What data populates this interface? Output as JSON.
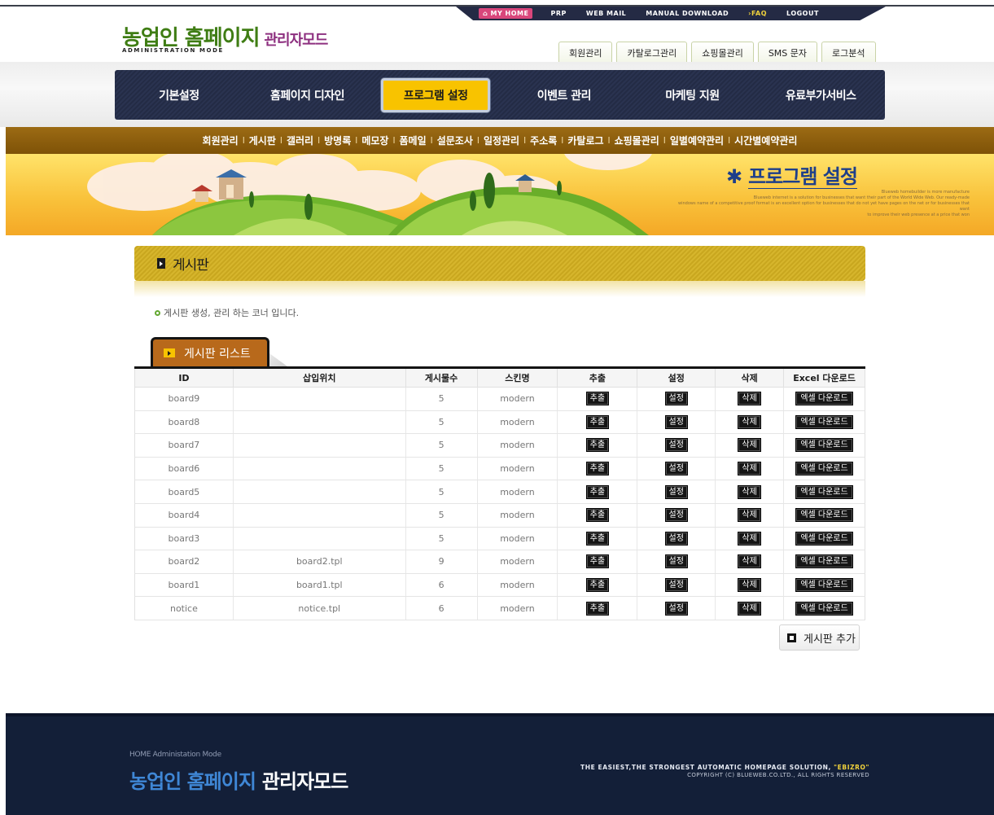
{
  "utility_nav": {
    "my_home": "MY HOME",
    "items": [
      "PRP",
      "WEB MAIL",
      "MANUAL DOWNLOAD",
      "FAQ",
      "LOGOUT"
    ]
  },
  "logo": {
    "main": "농업인 홈페이지",
    "sub": "관리자모드",
    "english": "ADMINISTRATION MODE"
  },
  "quick_tabs": [
    "회원관리",
    "카탈로그관리",
    "쇼핑몰관리",
    "SMS 문자",
    "로그분석"
  ],
  "main_nav": {
    "items": [
      "기본설정",
      "홈페이지 디자인",
      "프로그램 설정",
      "이벤트 관리",
      "마케팅 지원",
      "유료부가서비스"
    ],
    "active": "프로그램 설정"
  },
  "sub_nav": {
    "items": [
      "회원관리",
      "게시판",
      "갤러리",
      "방명록",
      "메모장",
      "폼메일",
      "설문조사",
      "일정관리",
      "주소록",
      "카탈로그",
      "쇼핑몰관리",
      "일별예약관리",
      "시간별예약관리"
    ],
    "separator": "l"
  },
  "banner": {
    "title": "프로그램 설정",
    "desc_lines": [
      "Blueweb homebuilder is more manufacture",
      "Blueweb internet is a solution for businesses that want their part of the World Wide Web. Our ready-made",
      "windows name of a competitive proof format is an excellent option for businesses that do not yet have pages on the net or for businesses that want",
      "to improve their web presence at a price that won"
    ]
  },
  "section": {
    "title": "게시판",
    "intro": "게시판 생성, 관리 하는 코너 입니다."
  },
  "list_tab": {
    "label": "게시판 리스트"
  },
  "table": {
    "headers": [
      "ID",
      "삽입위치",
      "게시물수",
      "스킨명",
      "추출",
      "설정",
      "삭제",
      "Excel 다운로드"
    ],
    "button_labels": {
      "extract": "추출",
      "settings": "설정",
      "delete": "삭제",
      "excel": "엑셀 다운로드"
    },
    "rows": [
      {
        "id": "board9",
        "position": "",
        "count": "5",
        "skin": "modern"
      },
      {
        "id": "board8",
        "position": "",
        "count": "5",
        "skin": "modern"
      },
      {
        "id": "board7",
        "position": "",
        "count": "5",
        "skin": "modern"
      },
      {
        "id": "board6",
        "position": "",
        "count": "5",
        "skin": "modern"
      },
      {
        "id": "board5",
        "position": "",
        "count": "5",
        "skin": "modern"
      },
      {
        "id": "board4",
        "position": "",
        "count": "5",
        "skin": "modern"
      },
      {
        "id": "board3",
        "position": "",
        "count": "5",
        "skin": "modern"
      },
      {
        "id": "board2",
        "position": "board2.tpl",
        "count": "9",
        "skin": "modern"
      },
      {
        "id": "board1",
        "position": "board1.tpl",
        "count": "6",
        "skin": "modern"
      },
      {
        "id": "notice",
        "position": "notice.tpl",
        "count": "6",
        "skin": "modern"
      }
    ]
  },
  "add_button": {
    "label": "게시판 추가"
  },
  "footer": {
    "small": "HOME Administation Mode",
    "logo_main": "농업인 홈페이지",
    "logo_sub": "관리자모드",
    "slogan": "THE EASIEST,THE STRONGEST AUTOMATIC HOMEPAGE SOLUTION,",
    "brand": "\"EBIZRO\"",
    "copyright": "COPYRIGHT (C) BLUEWEB.CO.LTD., ALL RIGHTS RESERVED"
  },
  "colors": {
    "nav_dark": "#232b45",
    "active_yellow": "#f8c300",
    "subnav_brown": "#8a5c0d",
    "logo_green": "#3f7d14",
    "logo_purple": "#8d2f7f",
    "footer_navy": "#131f38"
  }
}
